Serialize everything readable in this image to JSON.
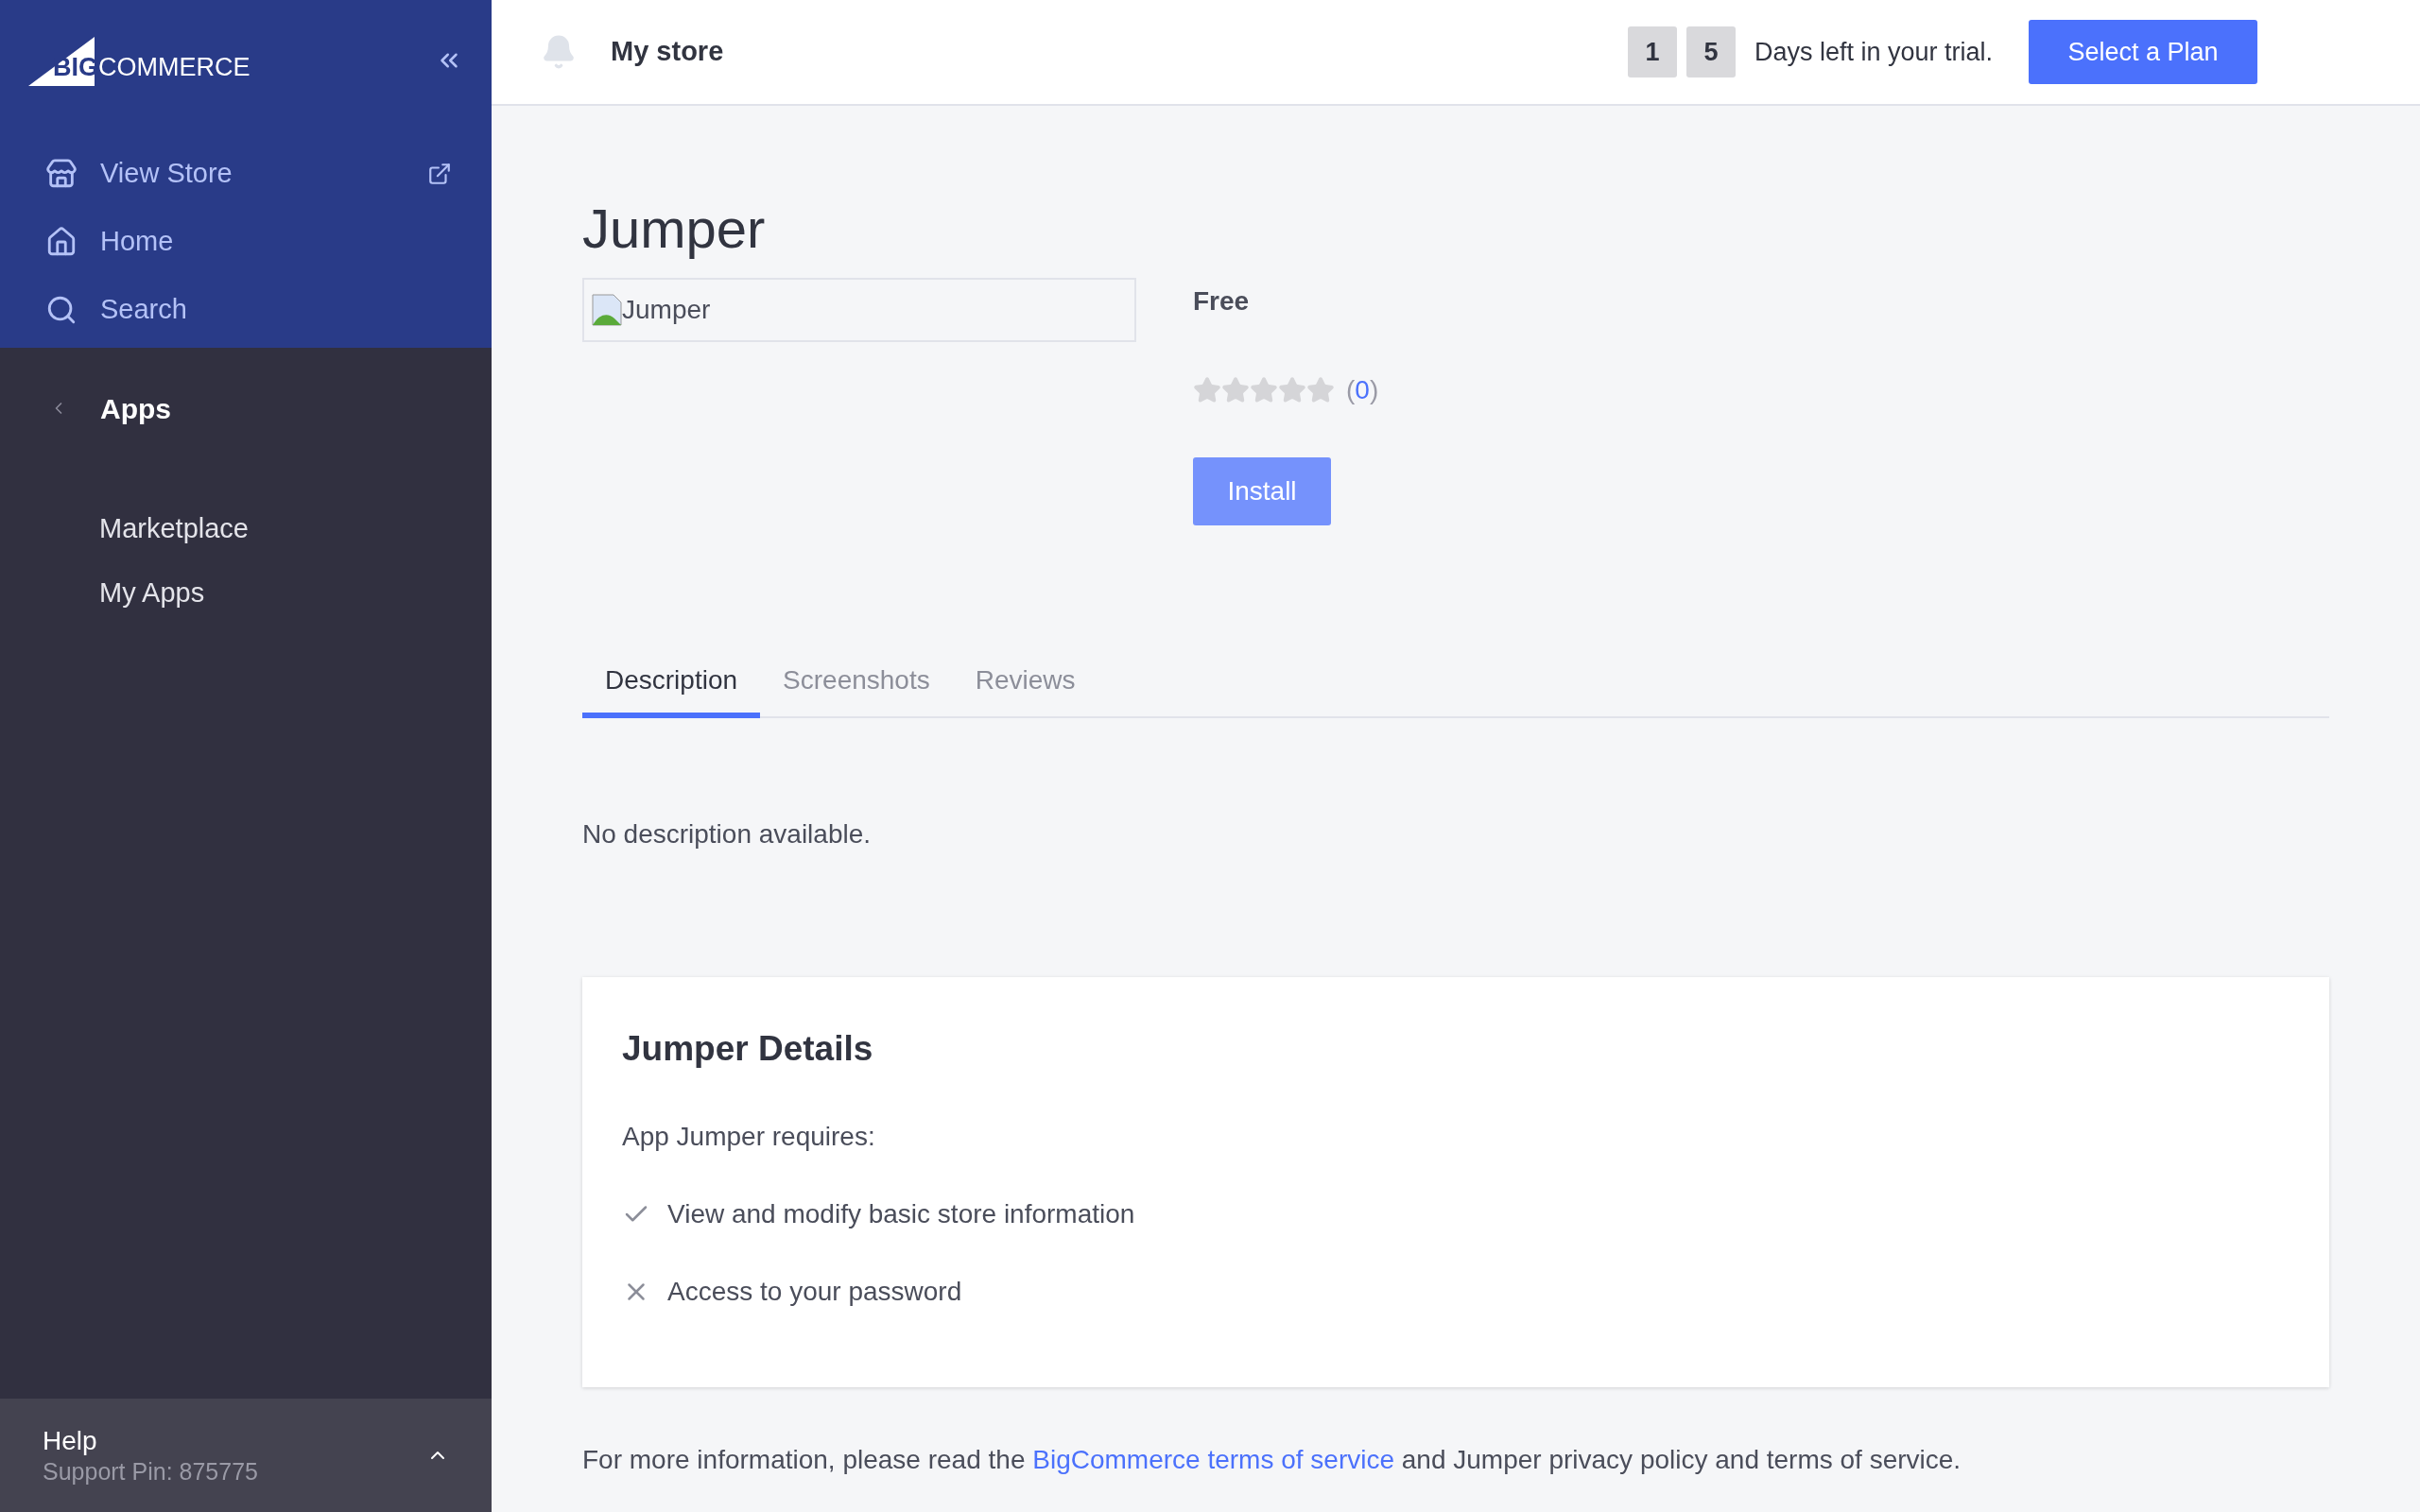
{
  "sidebar": {
    "logo": {
      "big": "BIG",
      "rest": "COMMERCE"
    },
    "top_items": [
      {
        "kind": "store",
        "label": "View Store",
        "external": true
      },
      {
        "kind": "home",
        "label": "Home",
        "external": false
      },
      {
        "kind": "search",
        "label": "Search",
        "external": false
      }
    ],
    "section": {
      "label": "Apps"
    },
    "items": [
      {
        "label": "Marketplace",
        "selected": false
      },
      {
        "label": "My Apps",
        "selected": false
      }
    ],
    "help": {
      "title": "Help",
      "pin": "Support Pin: 875775",
      "expanded": false
    }
  },
  "header": {
    "store": "My store",
    "trial_digits": [
      "1",
      "5"
    ],
    "trial_text": "Days left in your trial.",
    "plan_button": "Select a Plan"
  },
  "app": {
    "title": "Jumper",
    "image_alt": "Jumper",
    "price": "Free",
    "stars": 0,
    "rating": [
      "(",
      "0",
      ")"
    ],
    "install": "Install"
  },
  "tabs": [
    {
      "label": "Description",
      "selected": true
    },
    {
      "label": "Screenshots",
      "selected": false
    },
    {
      "label": "Reviews",
      "selected": false
    }
  ],
  "description": "No description available.",
  "details": {
    "title": "Jumper Details",
    "intro": "App Jumper requires:",
    "permissions": [
      {
        "kind": "granted",
        "label": "View and modify basic store information"
      },
      {
        "kind": "denied",
        "label": "Access to your password"
      }
    ]
  },
  "footer": {
    "before": "For more information, please read the ",
    "link": "BigCommerce terms of service",
    "after": " and Jumper privacy policy and terms of service."
  }
}
